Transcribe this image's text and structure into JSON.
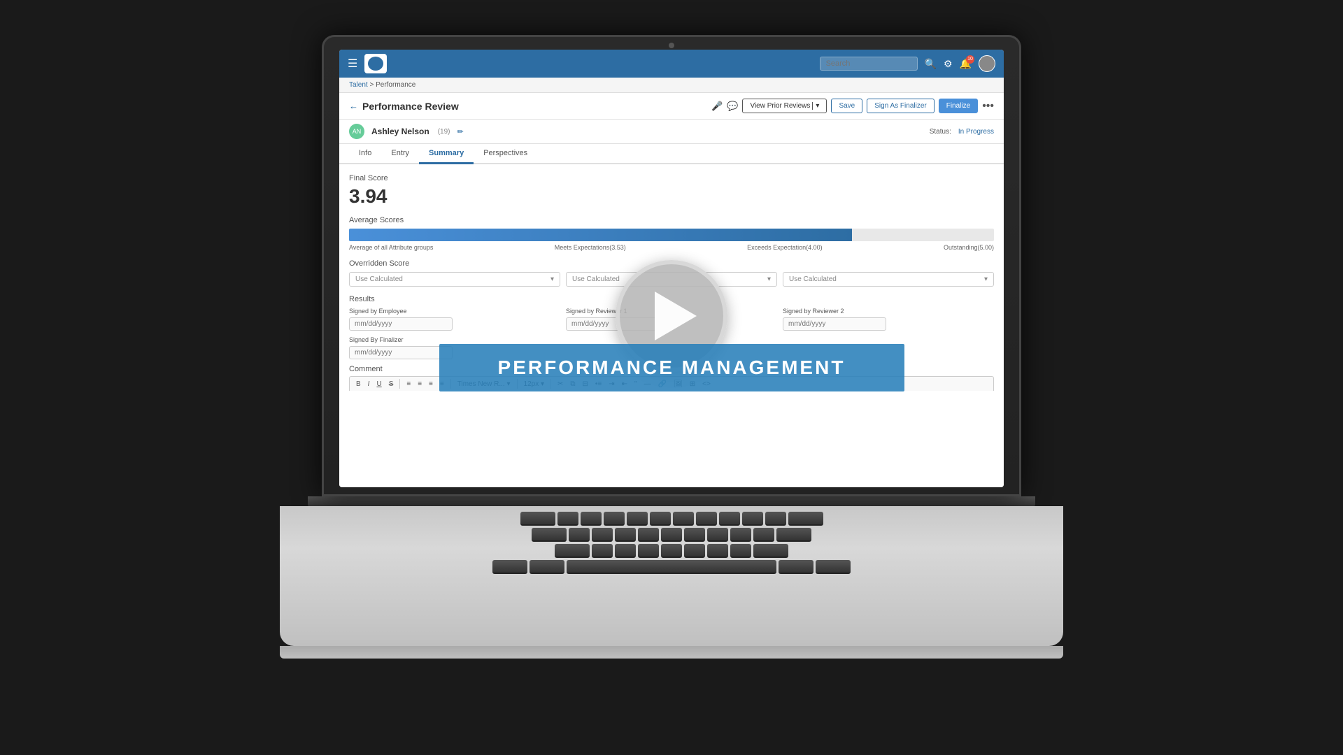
{
  "background_color": "#1a1a1a",
  "nav": {
    "search_placeholder": "Search",
    "notification_count": "10",
    "hamburger_label": "☰"
  },
  "breadcrumb": {
    "items": [
      "Talent",
      "Performance"
    ],
    "separator": " > "
  },
  "page": {
    "title": "Performance Review",
    "back_label": "←",
    "status": "Status: In Progress"
  },
  "header_buttons": {
    "view_prior_reviews": "View Prior Reviews",
    "save": "Save",
    "sign_as_finalizer": "Sign As Finalizer",
    "finalize": "Finalize"
  },
  "employee": {
    "name": "Ashley Nelson",
    "id": "(19)",
    "avatar_initials": "AN"
  },
  "tabs": {
    "items": [
      "Info",
      "Entry",
      "Summary",
      "Perspectives"
    ],
    "active": "Summary"
  },
  "content": {
    "final_score_label": "Final Score",
    "final_score_value": "3.94",
    "avg_scores_label": "Average Scores",
    "score_bar_labels": {
      "left": "Average of all Attribute groups",
      "center_left": "Meets Expectations(3.53)",
      "center_right": "Exceeds Expectation(4.00)",
      "right": "Outstanding(5.00)"
    },
    "overridden_score_label": "Overridden Score",
    "overridden_dropdowns": [
      "Use Calculated",
      "Use Calculated",
      "Use Calculated"
    ],
    "results_label": "Results",
    "results_columns": [
      "Signed by Employee",
      "Signed by Reviewer 1",
      "Signed by Reviewer 2"
    ],
    "results_placeholders": [
      "mm/dd/yyyy",
      "mm/dd/yyyy",
      "mm/dd/yyyy"
    ],
    "signed_by_finalizer_label": "Signed By Finalizer",
    "finalizer_placeholder": "mm/dd/yyyy",
    "comment_label": "Comment",
    "toolbar_buttons": [
      "B",
      "I",
      "U",
      "S",
      "≡",
      "≡",
      "≡",
      "≡",
      "Times New R...",
      "|",
      "12px",
      "|",
      "✂",
      "⧉",
      "⊟",
      "•",
      "¶",
      "«",
      "»",
      "«»",
      "¶",
      "⁂",
      "⌖",
      "↔",
      "⋯",
      "✎",
      "⬚",
      "⊞",
      "↔",
      "⊡",
      "≡",
      "↔"
    ]
  },
  "video": {
    "title": "PERFORMANCE MANAGEMENT",
    "play_label": "▶"
  }
}
